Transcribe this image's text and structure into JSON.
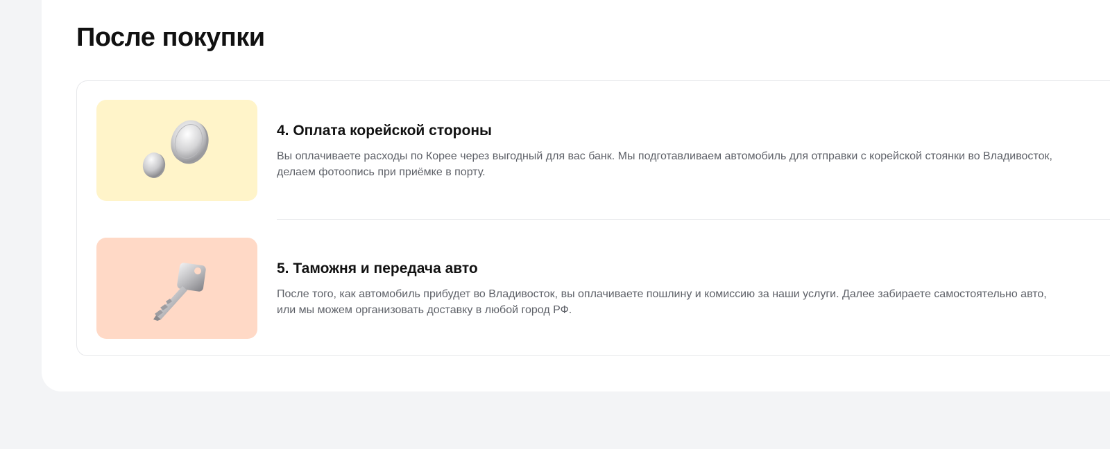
{
  "section": {
    "title": "После покупки"
  },
  "steps": [
    {
      "title": "4. Оплата корейской стороны",
      "description": "Вы оплачиваете расходы по Корее через выгодный для вас банк. Мы подготавливаем автомобиль для отправки с корейской стоянки во Владивосток, делаем фотоопись при приёмке в порту.",
      "icon": "coins-icon",
      "bg_color": "#fff4c9"
    },
    {
      "title": "5. Таможня и передача авто",
      "description": "После того, как автомобиль прибудет во Владивосток, вы оплачиваете пошлину и комиссию за наши услуги. Далее забираете самостоятельно авто, или мы можем организовать доставку в любой город РФ.",
      "icon": "key-icon",
      "bg_color": "#ffd9c6"
    }
  ],
  "colors": {
    "page_background": "#f3f4f6",
    "panel_background": "#ffffff",
    "border": "#e6e7ea",
    "title_text": "#111111",
    "body_text": "#5e6168"
  }
}
